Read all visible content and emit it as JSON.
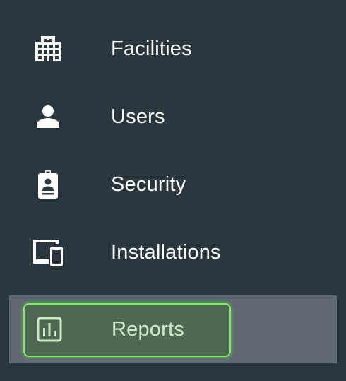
{
  "sidebar": {
    "items": [
      {
        "label": "Facilities",
        "icon": "building-icon"
      },
      {
        "label": "Users",
        "icon": "person-icon"
      },
      {
        "label": "Security",
        "icon": "id-badge-icon"
      },
      {
        "label": "Installations",
        "icon": "devices-icon"
      },
      {
        "label": "Reports",
        "icon": "bar-chart-icon",
        "selected": true
      }
    ]
  },
  "colors": {
    "background": "#29363e",
    "selected_row": "#5f6870",
    "selected_pill": "#4f6854",
    "focus_outline": "#7cf05e",
    "text": "#ffffff",
    "selected_text": "#cfe8c8"
  }
}
